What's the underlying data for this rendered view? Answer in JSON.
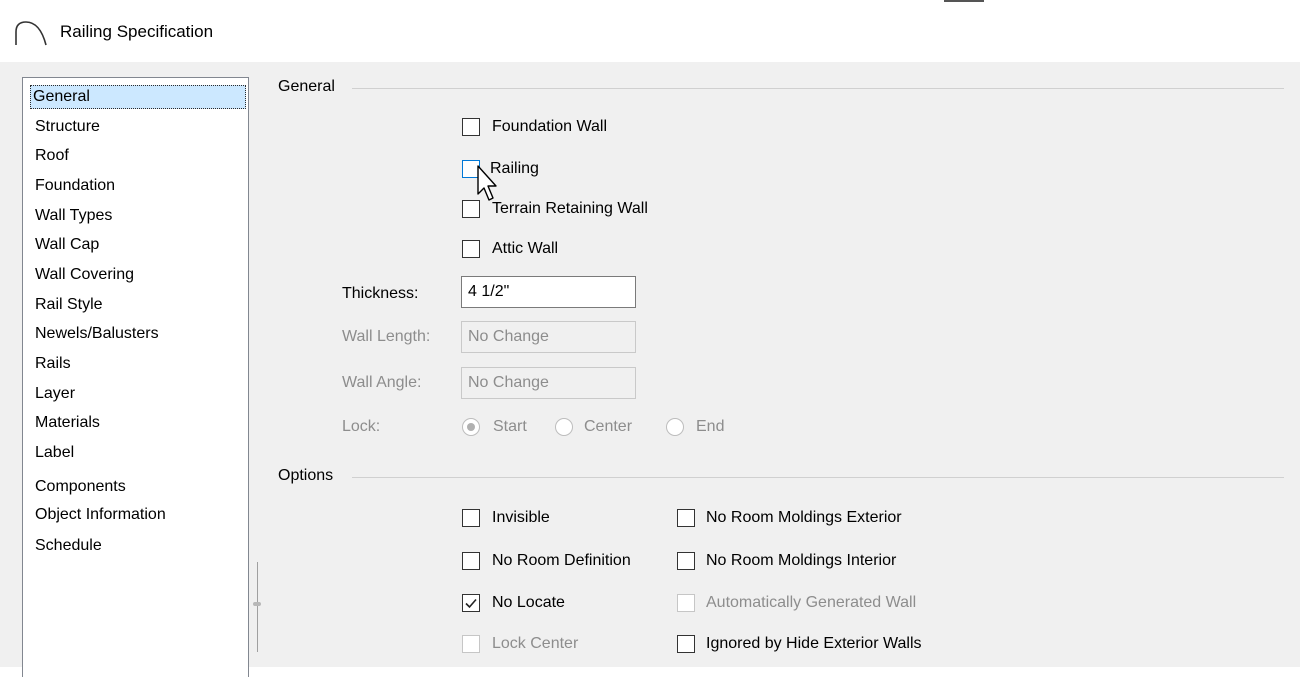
{
  "window": {
    "title": "Railing Specification"
  },
  "sidebar": {
    "items": [
      {
        "label": "General",
        "selected": true
      },
      {
        "label": "Structure"
      },
      {
        "label": "Roof"
      },
      {
        "label": "Foundation"
      },
      {
        "label": "Wall Types"
      },
      {
        "label": "Wall Cap"
      },
      {
        "label": "Wall Covering"
      },
      {
        "label": "Rail Style"
      },
      {
        "label": "Newels/Balusters"
      },
      {
        "label": "Rails"
      },
      {
        "label": "Layer"
      },
      {
        "label": "Materials"
      },
      {
        "label": "Label"
      },
      {
        "label": "Components"
      },
      {
        "label": "Object Information"
      },
      {
        "label": "Schedule"
      }
    ]
  },
  "general": {
    "group_label": "General",
    "foundation_wall": {
      "label": "Foundation Wall",
      "checked": false
    },
    "railing": {
      "label": "Railing",
      "checked": false
    },
    "terrain_retaining_wall": {
      "label": "Terrain Retaining Wall",
      "checked": false
    },
    "attic_wall": {
      "label": "Attic Wall",
      "checked": false
    },
    "thickness": {
      "label": "Thickness:",
      "value": "4 1/2\""
    },
    "wall_length": {
      "label": "Wall Length:",
      "value": "No Change"
    },
    "wall_angle": {
      "label": "Wall Angle:",
      "value": "No Change"
    },
    "lock": {
      "label": "Lock:",
      "options": [
        {
          "label": "Start",
          "selected": true
        },
        {
          "label": "Center",
          "selected": false
        },
        {
          "label": "End",
          "selected": false
        }
      ]
    }
  },
  "options": {
    "group_label": "Options",
    "invisible": {
      "label": "Invisible",
      "checked": false
    },
    "no_room_definition": {
      "label": "No Room Definition",
      "checked": false
    },
    "no_locate": {
      "label": "No Locate",
      "checked": true
    },
    "lock_center": {
      "label": "Lock Center",
      "checked": false,
      "disabled": true
    },
    "no_room_moldings_exterior": {
      "label": "No Room Moldings Exterior",
      "checked": false
    },
    "no_room_moldings_interior": {
      "label": "No Room Moldings Interior",
      "checked": false
    },
    "automatically_generated_wall": {
      "label": "Automatically Generated Wall",
      "checked": false,
      "disabled": true
    },
    "ignored_by_hide_exterior_walls": {
      "label": "Ignored by Hide Exterior Walls",
      "checked": false
    }
  },
  "colors": {
    "dialog_bg": "#f0f0f0",
    "selection_bg": "#cce8ff",
    "disabled_text": "#8d8d8d",
    "hover_border": "#0078d7"
  }
}
